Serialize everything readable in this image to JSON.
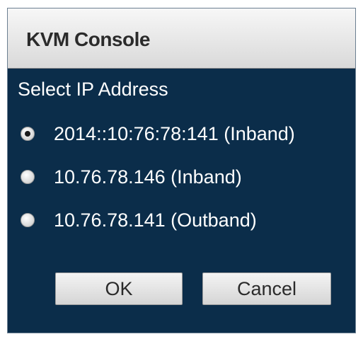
{
  "dialog": {
    "title": "KVM Console",
    "prompt": "Select IP Address",
    "options": [
      {
        "label": "2014::10:76:78:141 (Inband)",
        "selected": true
      },
      {
        "label": "10.76.78.146 (Inband)",
        "selected": false
      },
      {
        "label": "10.76.78.141 (Outband)",
        "selected": false
      }
    ],
    "buttons": {
      "ok_label": "OK",
      "cancel_label": "Cancel"
    }
  }
}
